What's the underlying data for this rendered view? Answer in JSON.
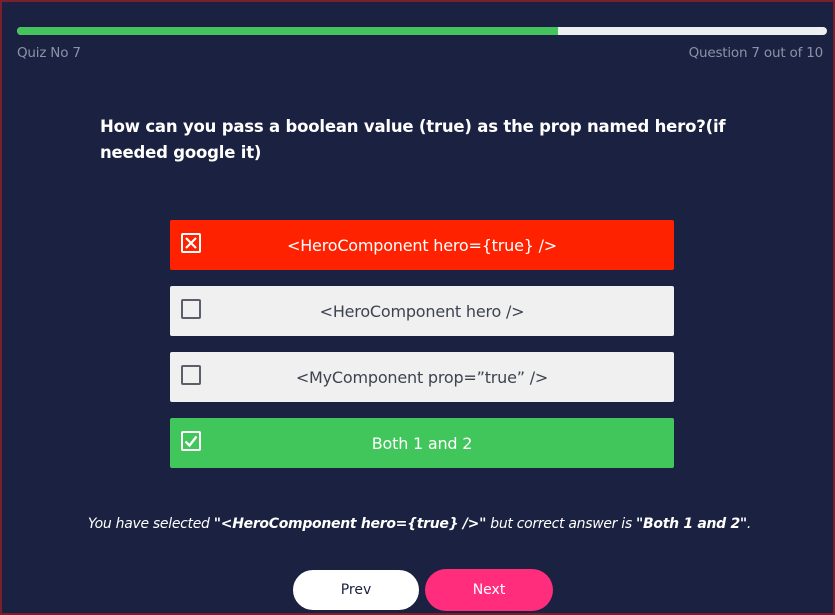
{
  "progress": {
    "value": 0.668
  },
  "header": {
    "quiz_label": "Quiz No 7",
    "question_counter": "Question 7 out of 10"
  },
  "question": {
    "text": "How can you pass a boolean value (true) as the prop named hero?(if needed google it)"
  },
  "options": [
    {
      "label": "<HeroComponent hero={true} />",
      "state": "wrong",
      "icon": "x-checkbox-icon"
    },
    {
      "label": "<HeroComponent hero />",
      "state": "unselected",
      "icon": "empty-checkbox-icon"
    },
    {
      "label": "<MyComponent prop=”true” />",
      "state": "unselected",
      "icon": "empty-checkbox-icon"
    },
    {
      "label": "Both 1 and 2",
      "state": "correct",
      "icon": "check-checkbox-icon"
    }
  ],
  "feedback": {
    "prefix": "You have selected ",
    "selected": "\"<HeroComponent hero={true} />\"",
    "middle": " but correct answer is ",
    "correct": "\"Both 1 and 2\"",
    "suffix": "."
  },
  "buttons": {
    "prev_label": "Prev",
    "next_label": "Next"
  },
  "colors": {
    "background": "#1b2140",
    "progress": "#45c45e",
    "wrong": "#ff2200",
    "correct": "#41c65b",
    "next": "#ff2d7c"
  }
}
